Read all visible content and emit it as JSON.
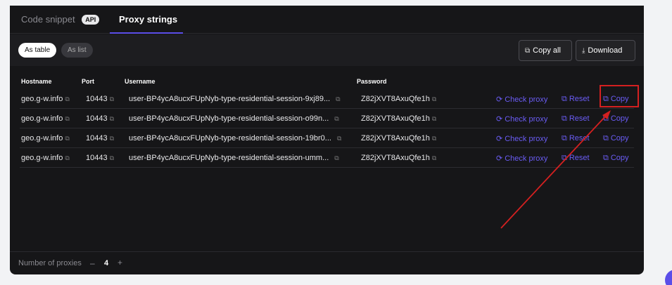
{
  "tabs": [
    {
      "label": "Code snippet",
      "badge": "API"
    },
    {
      "label": "Proxy strings"
    }
  ],
  "view_toggle": {
    "table_label": "As table",
    "list_label": "As list"
  },
  "actions": {
    "copy_all_label": "Copy all",
    "download_label": "Download"
  },
  "table": {
    "headers": [
      "Hostname",
      "Port",
      "Username",
      "Password"
    ],
    "rows": [
      {
        "hostname": "geo.g-w.info",
        "port": "10443",
        "username": "user-BP4ycA8ucxFUpNyb-type-residential-session-9xj89...",
        "password": "Z82jXVT8AxuQfe1h",
        "check": "Check proxy",
        "reset": "Reset",
        "copy": "Copy"
      },
      {
        "hostname": "geo.g-w.info",
        "port": "10443",
        "username": "user-BP4ycA8ucxFUpNyb-type-residential-session-o99n...",
        "password": "Z82jXVT8AxuQfe1h",
        "check": "Check proxy",
        "reset": "Reset",
        "copy": "Copy"
      },
      {
        "hostname": "geo.g-w.info",
        "port": "10443",
        "username": "user-BP4ycA8ucxFUpNyb-type-residential-session-19br0...",
        "password": "Z82jXVT8AxuQfe1h",
        "check": "Check proxy",
        "reset": "Reset",
        "copy": "Copy"
      },
      {
        "hostname": "geo.g-w.info",
        "port": "10443",
        "username": "user-BP4ycA8ucxFUpNyb-type-residential-session-umm...",
        "password": "Z82jXVT8AxuQfe1h",
        "check": "Check proxy",
        "reset": "Reset",
        "copy": "Copy"
      }
    ]
  },
  "footer": {
    "label": "Number of proxies",
    "minus": "–",
    "count": "4",
    "plus": "+"
  },
  "colors": {
    "accent": "#6a5cf4",
    "annotation": "#d42020",
    "panel": "#161618"
  }
}
